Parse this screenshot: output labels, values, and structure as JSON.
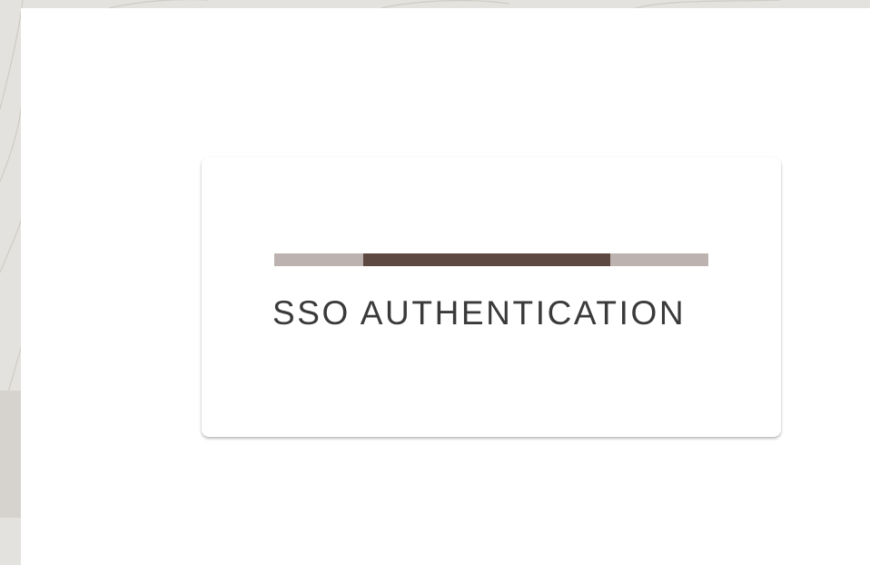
{
  "loading_card": {
    "status_text": "SSO AUTHENTICATION",
    "progress": {
      "indeterminate": true,
      "visible_segment_start": 0.205,
      "visible_segment_end": 0.775
    }
  },
  "colors": {
    "backdrop": "#e4e2de",
    "sheet": "#ffffff",
    "progress_track": "#bcb2af",
    "progress_fill": "#5d4842",
    "text": "#3a3a3a"
  }
}
